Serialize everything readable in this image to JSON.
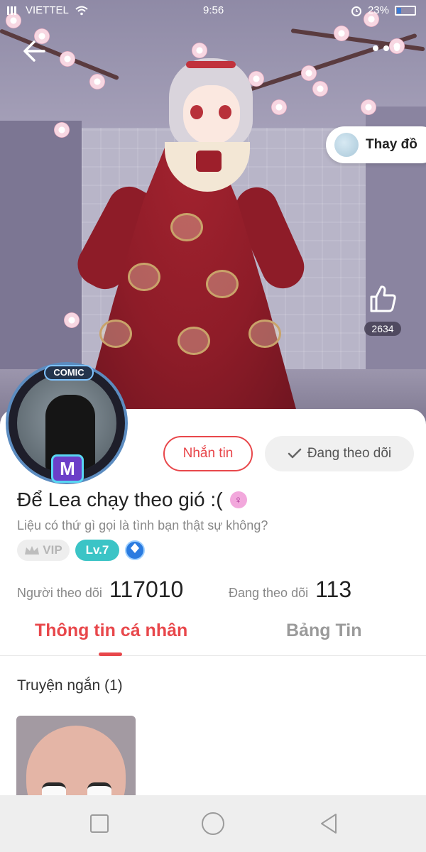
{
  "status_bar": {
    "carrier": "VIETTEL",
    "time": "9:56",
    "battery": "23%"
  },
  "header": {
    "back_icon": "arrow-left-icon",
    "more_icon": "more-dots-icon",
    "change_outfit_label": "Thay đồ",
    "like_count": "2634"
  },
  "profile": {
    "avatar_tag": "COMIC",
    "avatar_badge": "M",
    "message_button": "Nhắn tin",
    "following_button": "Đang theo dõi",
    "name": "Để Lea chạy theo gió :(",
    "bio": "Liệu có thứ gì gọi là tình bạn thật sự không?",
    "badges": {
      "vip": "VIP",
      "level": "Lv.7"
    },
    "stats": {
      "followers_label": "Người theo dõi",
      "followers_value": "117010",
      "following_label": "Đang theo dõi",
      "following_value": "113"
    }
  },
  "tabs": [
    {
      "label": "Thông tin cá nhân",
      "active": true
    },
    {
      "label": "Bảng Tin",
      "active": false
    }
  ],
  "content": {
    "section_title": "Truyện ngắn (1)"
  },
  "colors": {
    "accent": "#e8474b",
    "level_badge": "#3bc4c6",
    "muted_text": "#888888"
  }
}
